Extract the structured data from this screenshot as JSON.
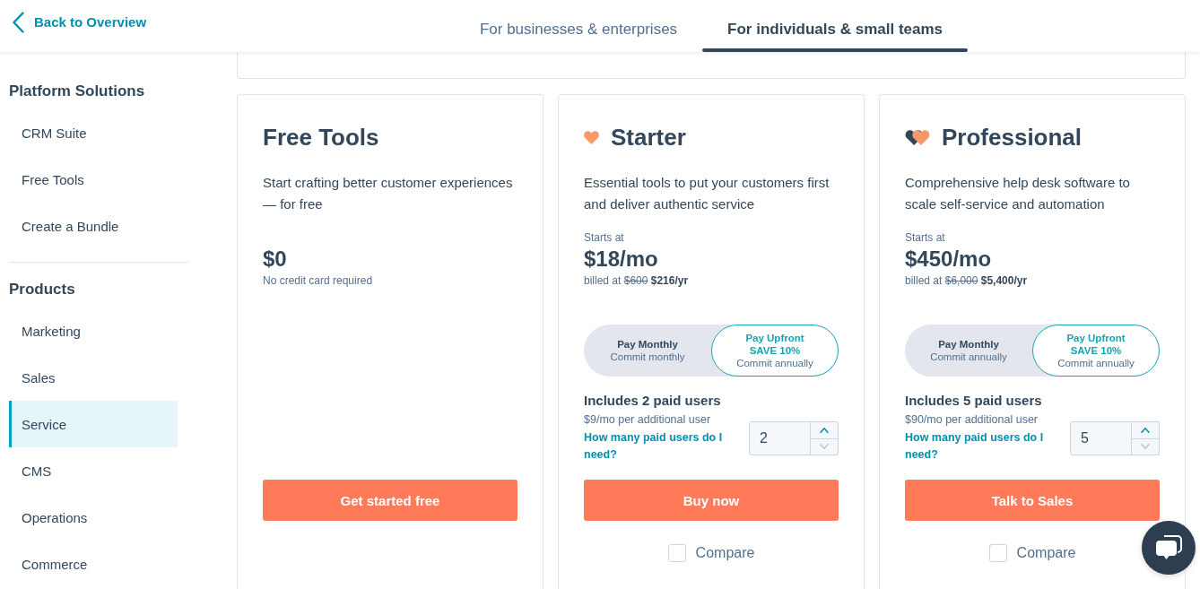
{
  "header": {
    "back_link": "Back to Overview",
    "tabs": [
      {
        "label": "For businesses & enterprises",
        "selected": false
      },
      {
        "label": "For individuals & small teams",
        "selected": true
      }
    ]
  },
  "sidebar": {
    "sections": [
      {
        "heading": "Platform Solutions",
        "items": [
          {
            "label": "CRM Suite",
            "selected": false
          },
          {
            "label": "Free Tools",
            "selected": false
          },
          {
            "label": "Create a Bundle",
            "selected": false
          }
        ]
      },
      {
        "heading": "Products",
        "items": [
          {
            "label": "Marketing",
            "selected": false
          },
          {
            "label": "Sales",
            "selected": false
          },
          {
            "label": "Service",
            "selected": true
          },
          {
            "label": "CMS",
            "selected": false
          },
          {
            "label": "Operations",
            "selected": false
          },
          {
            "label": "Commerce",
            "selected": false
          }
        ]
      }
    ]
  },
  "plans": [
    {
      "kind": "free",
      "name": "Free Tools",
      "description": "Start crafting better customer experiences — for free",
      "price": "$0",
      "price_note": "No credit card required",
      "cta": "Get started free"
    },
    {
      "kind": "starter",
      "name": "Starter",
      "description": "Essential tools to put your customers first and deliver authentic service",
      "starts_at": "Starts at",
      "price": "$18/mo",
      "billing": {
        "label": "billed at",
        "list_price": "$600",
        "price": "$216/yr"
      },
      "billing_options": [
        {
          "label": "Pay Monthly",
          "sublabel": "Commit monthly",
          "selected": false
        },
        {
          "label": "Pay Upfront",
          "badge": "SAVE 10%",
          "sublabel": "Commit annually",
          "selected": true
        }
      ],
      "users": {
        "title": "Includes 2 paid users",
        "extra": "$9/mo per additional user",
        "help_link": "How many paid users do I need?",
        "count": "2",
        "decrement_disabled": true
      },
      "cta": "Buy now",
      "compare": {
        "label": "Compare",
        "checked": false
      }
    },
    {
      "kind": "professional",
      "name": "Professional",
      "description": "Comprehensive help desk software to scale self-service and automation",
      "starts_at": "Starts at",
      "price": "$450/mo",
      "billing": {
        "label": "billed at",
        "list_price": "$6,000",
        "price": "$5,400/yr"
      },
      "billing_options": [
        {
          "label": "Pay Monthly",
          "sublabel": "Commit annually",
          "selected": false
        },
        {
          "label": "Pay Upfront",
          "badge": "SAVE 10%",
          "sublabel": "Commit annually",
          "selected": true
        }
      ],
      "users": {
        "title": "Includes 5 paid users",
        "extra": "$90/mo per additional user",
        "help_link": "How many paid users do I need?",
        "count": "5",
        "decrement_disabled": true
      },
      "cta": "Talk to Sales",
      "compare": {
        "label": "Compare",
        "checked": false
      }
    }
  ]
}
